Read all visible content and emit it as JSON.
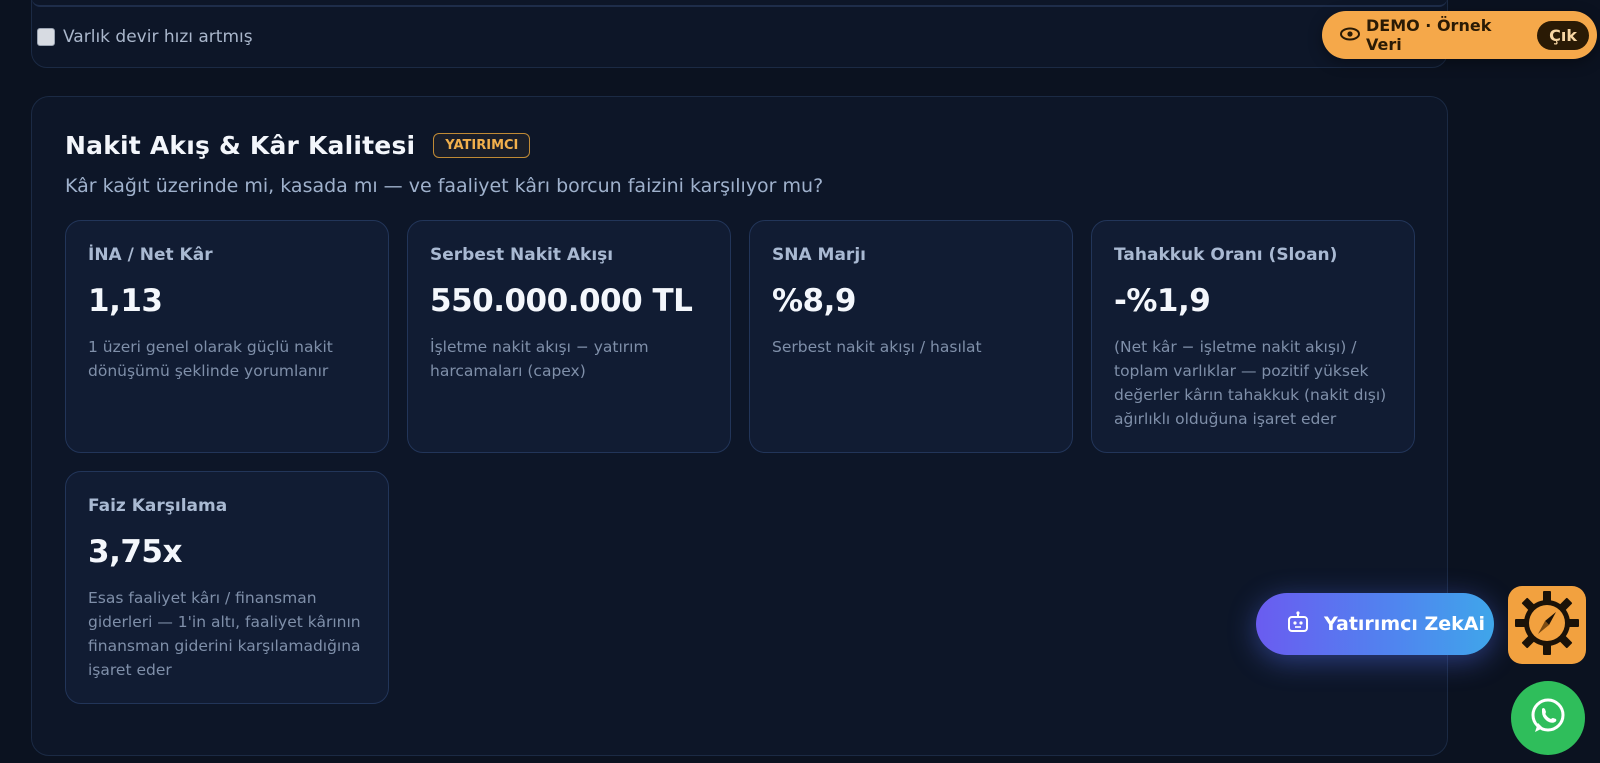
{
  "prev_section": {
    "checkbox_label": "Varlık devir hızı artmış"
  },
  "demo_banner": {
    "icon": "eye-icon",
    "label": "DEMO · Örnek Veri",
    "exit_label": "Çık"
  },
  "section": {
    "title": "Nakit Akış & Kâr Kalitesi",
    "badge": "YATIRIMCI",
    "subtitle": "Kâr kağıt üzerinde mi, kasada mı — ve faaliyet kârı borcun faizini karşılıyor mu?",
    "metrics": [
      {
        "label": "İNA / Net Kâr",
        "value": "1,13",
        "desc": "1 üzeri genel olarak güçlü nakit dönüşümü şeklinde yorumlanır"
      },
      {
        "label": "Serbest Nakit Akışı",
        "value": "550.000.000 TL",
        "desc": "İşletme nakit akışı − yatırım harcamaları (capex)"
      },
      {
        "label": "SNA Marjı",
        "value": "%8,9",
        "desc": "Serbest nakit akışı / hasılat"
      },
      {
        "label": "Tahakkuk Oranı (Sloan)",
        "value": "-%1,9",
        "desc": "(Net kâr − işletme nakit akışı) / toplam varlıklar — pozitif yüksek değerler kârın tahakkuk (nakit dışı) ağırlıklı olduğuna işaret eder"
      },
      {
        "label": "Faiz Karşılama",
        "value": "3,75x",
        "desc": "Esas faaliyet kârı / finansman giderleri — 1'in altı, faaliyet kârının finansman giderini karşılamadığına işaret eder"
      }
    ]
  },
  "floating": {
    "ai_button_label": "Yatırımcı ZekAi",
    "ai_icon": "robot-icon",
    "gear_icon": "gear-compass-icon",
    "whatsapp_icon": "whatsapp-icon"
  },
  "colors": {
    "background": "#0b1220",
    "card": "#111c33",
    "accent_orange": "#f5a84a",
    "ai_gradient_start": "#6a5cf0",
    "ai_gradient_end": "#3fa6ea",
    "whatsapp_green": "#2fbe5b"
  }
}
